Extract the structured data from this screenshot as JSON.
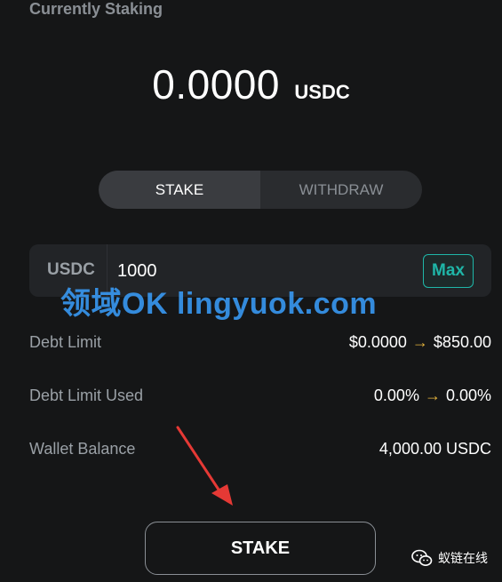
{
  "header": {
    "title": "Currently Staking"
  },
  "staking": {
    "amount": "0.0000",
    "unit": "USDC"
  },
  "tabs": [
    {
      "label": "STAKE",
      "active": true
    },
    {
      "label": "WITHDRAW",
      "active": false
    }
  ],
  "input": {
    "currency": "USDC",
    "value": "1000",
    "max_label": "Max"
  },
  "watermark": "领域OK lingyuok.com",
  "info": {
    "debt_limit": {
      "label": "Debt Limit",
      "from": "$0.0000",
      "to": "$850.00"
    },
    "debt_limit_used": {
      "label": "Debt Limit Used",
      "from": "0.00%",
      "to": "0.00%"
    },
    "wallet_balance": {
      "label": "Wallet Balance",
      "value": "4,000.00 USDC"
    }
  },
  "arrow_glyph": "→",
  "stake_button": {
    "label": "STAKE"
  },
  "wechat": {
    "label": "蚁链在线"
  },
  "colors": {
    "background": "#151617",
    "accent": "#1fb6a8",
    "arrow": "#e3b23c",
    "annotation": "#e53935"
  }
}
